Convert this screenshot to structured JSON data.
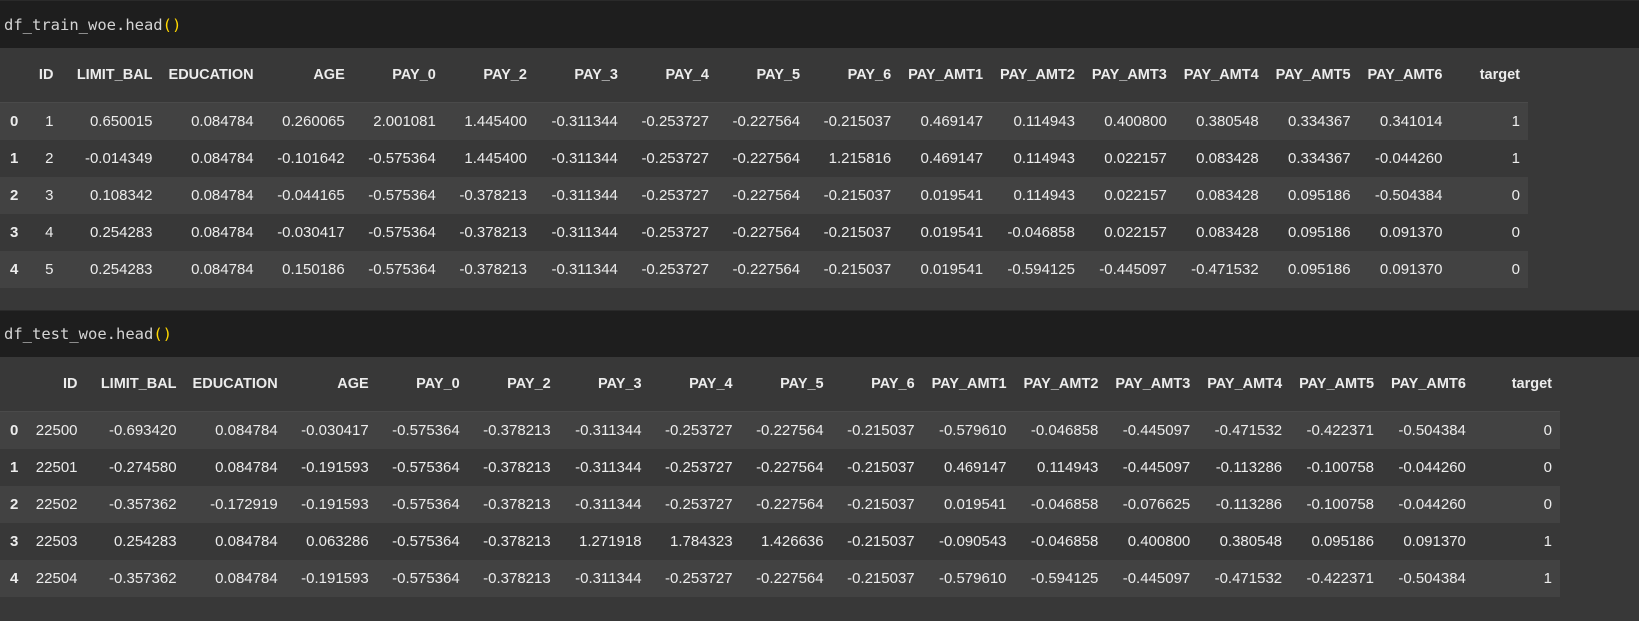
{
  "cells": [
    {
      "code": {
        "name": "df_train_woe.head",
        "open": "(",
        "close": ")"
      },
      "columns": [
        "",
        "ID",
        "LIMIT_BAL",
        "EDUCATION",
        "AGE",
        "PAY_0",
        "PAY_2",
        "PAY_3",
        "PAY_4",
        "PAY_5",
        "PAY_6",
        "PAY_AMT1",
        "PAY_AMT2",
        "PAY_AMT3",
        "PAY_AMT4",
        "PAY_AMT5",
        "PAY_AMT6",
        "target"
      ],
      "rows": [
        [
          "0",
          "1",
          "0.650015",
          "0.084784",
          "0.260065",
          "2.001081",
          "1.445400",
          "-0.311344",
          "-0.253727",
          "-0.227564",
          "-0.215037",
          "0.469147",
          "0.114943",
          "0.400800",
          "0.380548",
          "0.334367",
          "0.341014",
          "1"
        ],
        [
          "1",
          "2",
          "-0.014349",
          "0.084784",
          "-0.101642",
          "-0.575364",
          "1.445400",
          "-0.311344",
          "-0.253727",
          "-0.227564",
          "1.215816",
          "0.469147",
          "0.114943",
          "0.022157",
          "0.083428",
          "0.334367",
          "-0.044260",
          "1"
        ],
        [
          "2",
          "3",
          "0.108342",
          "0.084784",
          "-0.044165",
          "-0.575364",
          "-0.378213",
          "-0.311344",
          "-0.253727",
          "-0.227564",
          "-0.215037",
          "0.019541",
          "0.114943",
          "0.022157",
          "0.083428",
          "0.095186",
          "-0.504384",
          "0"
        ],
        [
          "3",
          "4",
          "0.254283",
          "0.084784",
          "-0.030417",
          "-0.575364",
          "-0.378213",
          "-0.311344",
          "-0.253727",
          "-0.227564",
          "-0.215037",
          "0.019541",
          "-0.046858",
          "0.022157",
          "0.083428",
          "0.095186",
          "0.091370",
          "0"
        ],
        [
          "4",
          "5",
          "0.254283",
          "0.084784",
          "0.150186",
          "-0.575364",
          "-0.378213",
          "-0.311344",
          "-0.253727",
          "-0.227564",
          "-0.215037",
          "0.019541",
          "-0.594125",
          "-0.445097",
          "-0.471532",
          "0.095186",
          "0.091370",
          "0"
        ]
      ]
    },
    {
      "code": {
        "name": "df_test_woe.head",
        "open": "(",
        "close": ")"
      },
      "columns": [
        "",
        "ID",
        "LIMIT_BAL",
        "EDUCATION",
        "AGE",
        "PAY_0",
        "PAY_2",
        "PAY_3",
        "PAY_4",
        "PAY_5",
        "PAY_6",
        "PAY_AMT1",
        "PAY_AMT2",
        "PAY_AMT3",
        "PAY_AMT4",
        "PAY_AMT5",
        "PAY_AMT6",
        "target"
      ],
      "rows": [
        [
          "0",
          "22500",
          "-0.693420",
          "0.084784",
          "-0.030417",
          "-0.575364",
          "-0.378213",
          "-0.311344",
          "-0.253727",
          "-0.227564",
          "-0.215037",
          "-0.579610",
          "-0.046858",
          "-0.445097",
          "-0.471532",
          "-0.422371",
          "-0.504384",
          "0"
        ],
        [
          "1",
          "22501",
          "-0.274580",
          "0.084784",
          "-0.191593",
          "-0.575364",
          "-0.378213",
          "-0.311344",
          "-0.253727",
          "-0.227564",
          "-0.215037",
          "0.469147",
          "0.114943",
          "-0.445097",
          "-0.113286",
          "-0.100758",
          "-0.044260",
          "0"
        ],
        [
          "2",
          "22502",
          "-0.357362",
          "-0.172919",
          "-0.191593",
          "-0.575364",
          "-0.378213",
          "-0.311344",
          "-0.253727",
          "-0.227564",
          "-0.215037",
          "0.019541",
          "-0.046858",
          "-0.076625",
          "-0.113286",
          "-0.100758",
          "-0.044260",
          "0"
        ],
        [
          "3",
          "22503",
          "0.254283",
          "0.084784",
          "0.063286",
          "-0.575364",
          "-0.378213",
          "1.271918",
          "1.784323",
          "1.426636",
          "-0.215037",
          "-0.090543",
          "-0.046858",
          "0.400800",
          "0.380548",
          "0.095186",
          "0.091370",
          "1"
        ],
        [
          "4",
          "22504",
          "-0.357362",
          "0.084784",
          "-0.191593",
          "-0.575364",
          "-0.378213",
          "-0.311344",
          "-0.253727",
          "-0.227564",
          "-0.215037",
          "-0.579610",
          "-0.594125",
          "-0.445097",
          "-0.471532",
          "-0.422371",
          "-0.504384",
          "1"
        ]
      ]
    }
  ]
}
